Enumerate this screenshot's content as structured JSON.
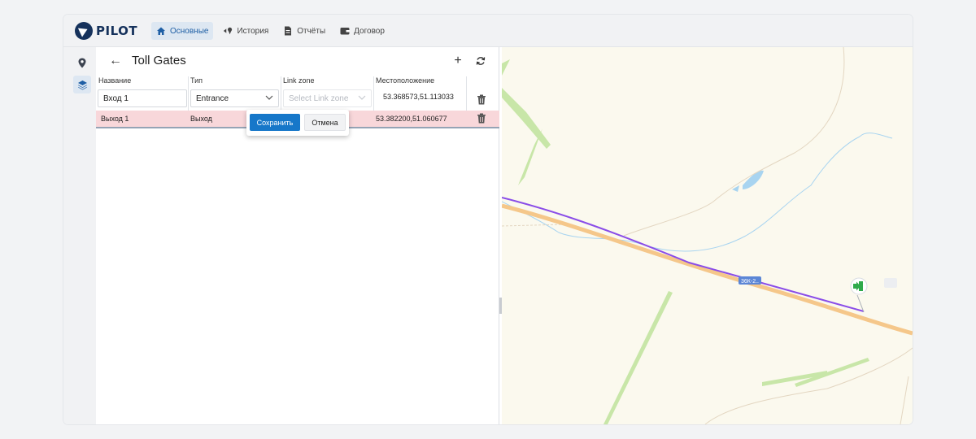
{
  "app": {
    "logo_text": "PILOT",
    "brand_color": "#16325c",
    "accent_color": "#1677c9"
  },
  "nav": {
    "items": [
      {
        "label": "Основные",
        "icon": "home-icon",
        "active": true
      },
      {
        "label": "История",
        "icon": "route-icon",
        "active": false
      },
      {
        "label": "Отчёты",
        "icon": "report-icon",
        "active": false
      },
      {
        "label": "Договор",
        "icon": "wallet-icon",
        "active": false
      }
    ]
  },
  "rail": {
    "items": [
      {
        "icon": "map-pin-icon",
        "active": false
      },
      {
        "icon": "layers-icon",
        "active": true
      }
    ]
  },
  "panel": {
    "back_icon": "←",
    "title": "Toll Gates",
    "add_icon": "+",
    "refresh_icon": "refresh-icon",
    "columns": [
      "Название",
      "Тип",
      "Link zone",
      "Местоположение"
    ]
  },
  "edit_row": {
    "name_value": "Вход 1",
    "type_value": "Entrance",
    "link_zone_placeholder": "Select Link zone",
    "location_value": "53.368573,51.113033"
  },
  "rows": [
    {
      "name": "Выход 1",
      "type": "Выход",
      "location": "53.382200,51.060677",
      "highlight_color": "#f8d7da"
    }
  ],
  "popover": {
    "save_label": "Сохранить",
    "cancel_label": "Отмена"
  },
  "map": {
    "road_label": "36К-2..",
    "route_color": "#8a4de8",
    "marker_icon": "exit-gate-icon"
  }
}
